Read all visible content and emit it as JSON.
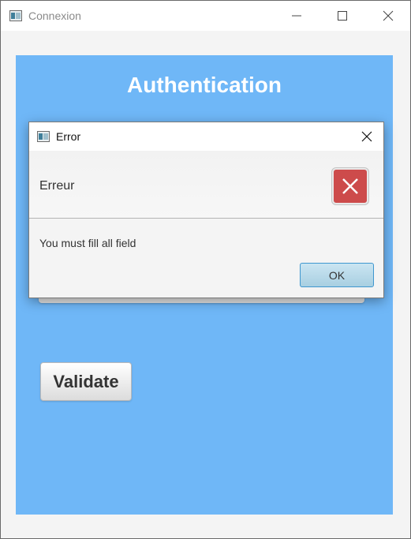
{
  "window": {
    "title": "Connexion",
    "app_icon": "java-app-icon",
    "controls": [
      "minimize-icon",
      "maximize-icon",
      "close-icon"
    ]
  },
  "main": {
    "heading": "Authentication",
    "validate_label": "Validate",
    "background_color": "#6fb7f7"
  },
  "dialog": {
    "title": "Error",
    "header": "Erreur",
    "message": "You must fill all field",
    "ok_label": "OK",
    "icon": "error-x-icon",
    "icon_color": "#cd4b4b"
  }
}
